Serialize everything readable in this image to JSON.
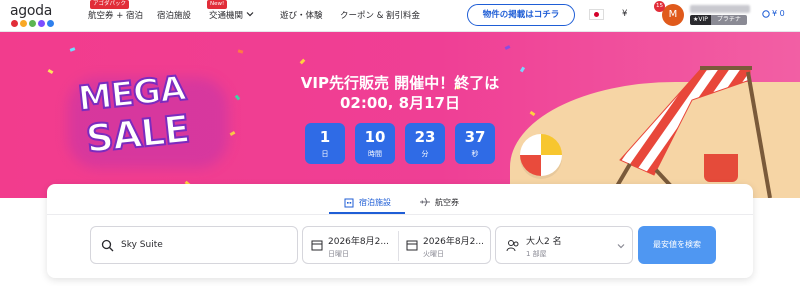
{
  "nav": {
    "logo_text": "agoda",
    "logo_colors": [
      "#e12d39",
      "#f9a825",
      "#5db553",
      "#7c4dff",
      "#2f80ed"
    ],
    "items": [
      {
        "label": "航空券 + 宿泊",
        "badge": "アゴダパック"
      },
      {
        "label": "宿泊施設",
        "badge": ""
      },
      {
        "label": "交通機関",
        "badge": "New!"
      },
      {
        "label": "遊び・体験",
        "badge": ""
      },
      {
        "label": "クーポン & 割引料金",
        "badge": ""
      }
    ],
    "host_button": "物件の掲載はコチラ",
    "currency_symbol": "¥",
    "avatar_initial": "M",
    "avatar_badge": "15",
    "vip_label": "★VIP",
    "tier_label": "プラチナ",
    "points": "¥ 0"
  },
  "hero": {
    "mega": "MEGA",
    "sale": "SALE",
    "title": "VIP先行販売 開催中！終了は",
    "end_time": "02:00, 8月17日",
    "countdown": [
      {
        "value": "1",
        "unit": "日"
      },
      {
        "value": "10",
        "unit": "時間"
      },
      {
        "value": "23",
        "unit": "分"
      },
      {
        "value": "37",
        "unit": "秒"
      }
    ]
  },
  "search": {
    "tabs": [
      {
        "label": "宿泊施設",
        "icon": "hotel-icon",
        "active": true
      },
      {
        "label": "航空券",
        "icon": "plane-icon",
        "active": false
      }
    ],
    "destination": "Sky Suite",
    "checkin": {
      "date": "2026年8月2...",
      "weekday": "日曜日"
    },
    "checkout": {
      "date": "2026年8月2...",
      "weekday": "火曜日"
    },
    "guests": {
      "main": "大人2 名",
      "rooms": "1 部屋"
    },
    "button": "最安値を検索"
  },
  "colors": {
    "brand_blue": "#1f5ed6",
    "hero_pink": "#ef3f95",
    "countdown_blue": "#2f6be6",
    "search_button": "#4f97f2"
  }
}
